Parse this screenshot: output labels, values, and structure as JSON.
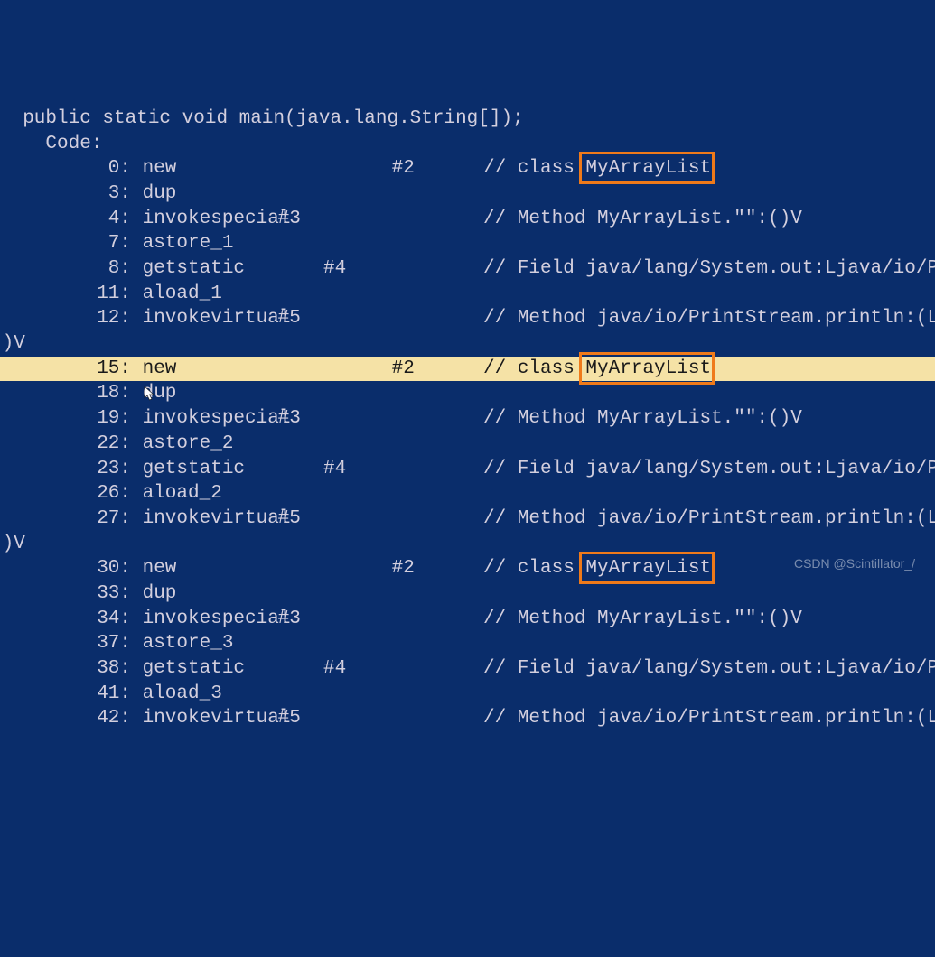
{
  "signature": "  public static void main(java.lang.String[]);",
  "code_label": "    Code:",
  "margin_v": ";)V",
  "rows": [
    {
      "offset": "       0:",
      "op": " new",
      "ref": "           #2",
      "c": "// class ",
      "t": "MyArrayList",
      "box": true
    },
    {
      "offset": "       3:",
      "op": " dup",
      "ref": "",
      "c": "",
      "t": ""
    },
    {
      "offset": "       4:",
      "op": " invokespecial",
      "ref": " #3",
      "c": "// Method MyArrayList.\"<init>\":()V",
      "t": ""
    },
    {
      "offset": "       7:",
      "op": " astore_1",
      "ref": "",
      "c": "",
      "t": ""
    },
    {
      "offset": "       8:",
      "op": " getstatic",
      "ref": "     #4",
      "c": "// Field java/lang/System.out:Ljava/io/Prin",
      "t": ""
    },
    {
      "offset": "      11:",
      "op": " aload_1",
      "ref": "",
      "c": "",
      "t": ""
    },
    {
      "offset": "      12:",
      "op": " invokevirtual",
      "ref": " #5",
      "c": "// Method java/io/PrintStream.println:(Ljav",
      "t": ""
    },
    {
      "offset": "",
      "op": "",
      "ref": "",
      "c": "",
      "t": "",
      "margin": true
    },
    {
      "offset": "      15:",
      "op": " new",
      "ref": "           #2",
      "c": "// class ",
      "t": "MyArrayList",
      "hl": true,
      "box": true
    },
    {
      "offset": "      18:",
      "op": " dup",
      "ref": "",
      "c": "",
      "t": ""
    },
    {
      "offset": "      19:",
      "op": " invokespecial",
      "ref": " #3",
      "c": "// Method MyArrayList.\"<init>\":()V",
      "t": ""
    },
    {
      "offset": "      22:",
      "op": " astore_2",
      "ref": "",
      "c": "",
      "t": ""
    },
    {
      "offset": "      23:",
      "op": " getstatic",
      "ref": "     #4",
      "c": "// Field java/lang/System.out:Ljava/io/Prin",
      "t": ""
    },
    {
      "offset": "      26:",
      "op": " aload_2",
      "ref": "",
      "c": "",
      "t": ""
    },
    {
      "offset": "      27:",
      "op": " invokevirtual",
      "ref": " #5",
      "c": "// Method java/io/PrintStream.println:(Ljav",
      "t": ""
    },
    {
      "offset": "",
      "op": "",
      "ref": "",
      "c": "",
      "t": "",
      "margin": true
    },
    {
      "offset": "      30:",
      "op": " new",
      "ref": "           #2",
      "c": "// class ",
      "t": "MyArrayList",
      "box": true
    },
    {
      "offset": "      33:",
      "op": " dup",
      "ref": "",
      "c": "",
      "t": ""
    },
    {
      "offset": "      34:",
      "op": " invokespecial",
      "ref": " #3",
      "c": "// Method MyArrayList.\"<init>\":()V",
      "t": ""
    },
    {
      "offset": "      37:",
      "op": " astore_3",
      "ref": "",
      "c": "",
      "t": ""
    },
    {
      "offset": "      38:",
      "op": " getstatic",
      "ref": "     #4",
      "c": "// Field java/lang/System.out:Ljava/io/Prin",
      "t": ""
    },
    {
      "offset": "      41:",
      "op": " aload_3",
      "ref": "",
      "c": "",
      "t": ""
    },
    {
      "offset": "      42:",
      "op": " invokevirtual",
      "ref": " #5",
      "c": "// Method java/io/PrintStream.println:(Ljav",
      "t": ""
    }
  ],
  "watermark": "CSDN @Scintillator_/"
}
